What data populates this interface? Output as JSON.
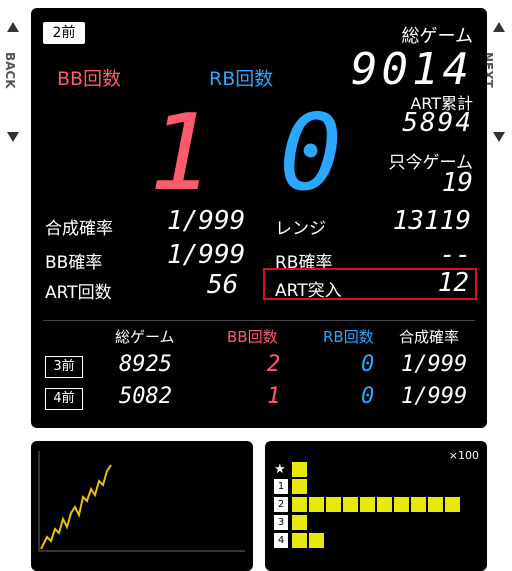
{
  "nav": {
    "back_label": "BACK",
    "next_label": "NEXT"
  },
  "badge": "2前",
  "current": {
    "bb_label": "BB回数",
    "rb_label": "RB回数",
    "bb_count": "1",
    "rb_count": "0",
    "total_games_label": "総ゲーム",
    "total_games": "9014",
    "art_total_label": "ART累計",
    "art_total": "5894",
    "now_games_label": "只今ゲーム",
    "now_games": "19"
  },
  "stats": {
    "combined_rate_label": "合成確率",
    "combined_rate": "1/999",
    "bb_rate_label": "BB確率",
    "bb_rate": "1/999",
    "art_count_label": "ART回数",
    "art_count": "56",
    "range_label": "レンジ",
    "range": "13119",
    "rb_rate_label": "RB確率",
    "rb_rate": "--",
    "art_entry_label": "ART突入",
    "art_entry": "12"
  },
  "history": {
    "headers": {
      "total_games": "総ゲーム",
      "bb": "BB回数",
      "rb": "RB回数",
      "combined": "合成確率"
    },
    "rows": [
      {
        "tag": "3前",
        "total_games": "8925",
        "bb": "2",
        "rb": "0",
        "combined": "1/999"
      },
      {
        "tag": "4前",
        "total_games": "5082",
        "bb": "1",
        "rb": "0",
        "combined": "1/999"
      }
    ]
  },
  "bar_chart": {
    "scale_label": "×100",
    "star": "★",
    "rows": [
      {
        "label": "1",
        "value": 1
      },
      {
        "label": "2",
        "value": 10
      },
      {
        "label": "3",
        "value": 1
      },
      {
        "label": "4",
        "value": 2
      }
    ]
  },
  "colors": {
    "bb": "#ff5a6e",
    "rb": "#2aa8ff",
    "graph_line": "#e8c20a",
    "bar": "#e8e80a",
    "highlight_box": "#d11111"
  }
}
